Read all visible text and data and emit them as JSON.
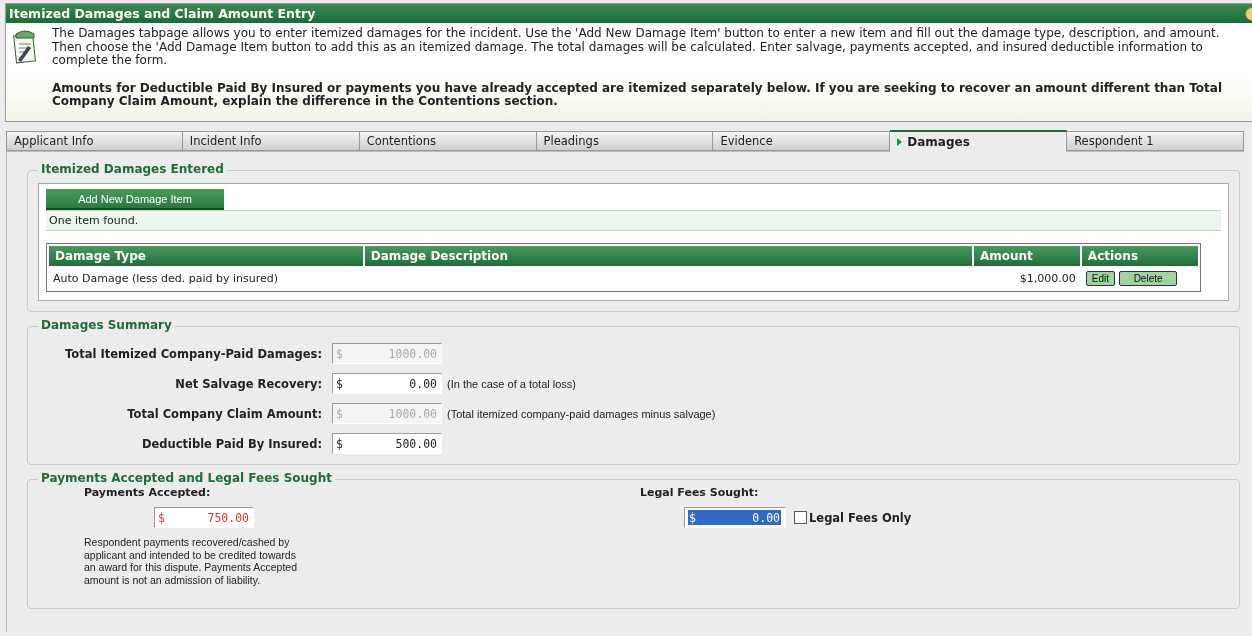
{
  "window": {
    "title": "Itemized Damages and Claim Amount Entry"
  },
  "intro": {
    "paragraphs": [
      {
        "kind": "note",
        "text": "The Damages tabpage allows you to enter itemized damages for the incident. Use the 'Add New Damage Item' button to enter a new item and fill out the damage type, description, and amount. Then choose the 'Add Damage Item button to add this as an itemized damage. The total damages will be calculated. Enter salvage, payments accepted, and insured deductible information to complete the form."
      },
      {
        "kind": "emphasis",
        "text": "Amounts for Deductible Paid By Insured or payments you have already accepted are itemized separately below. If you are seeking to recover an amount different than Total Company Claim Amount, explain the difference in the Contentions section."
      }
    ]
  },
  "tabs": [
    {
      "label": "Applicant Info",
      "selected": false
    },
    {
      "label": "Incident Info",
      "selected": false
    },
    {
      "label": "Contentions",
      "selected": false
    },
    {
      "label": "Pleadings",
      "selected": false
    },
    {
      "label": "Evidence",
      "selected": false
    },
    {
      "label": "Damages",
      "selected": true
    },
    {
      "label": "Respondent 1",
      "selected": false
    }
  ],
  "itemized": {
    "title": "Itemized Damages Entered",
    "add_button": "Add New Damage Item",
    "result_count": "One item found.",
    "table": {
      "columns": [
        "Damage Type",
        "Damage Description",
        "Amount",
        "Actions"
      ],
      "rows": [
        {
          "damage_type": "Auto Damage (less ded. paid by insured)",
          "amount": "$1,000.00",
          "actions": [
            "Edit",
            "Delete"
          ]
        }
      ]
    }
  },
  "summary": {
    "title": "Damages Summary",
    "fields": [
      {
        "label": "Total Itemized Company-Paid Damages:",
        "currency": "$",
        "value": "1000.00",
        "disabled": true
      },
      {
        "label": "Net Salvage Recovery:",
        "currency": "$",
        "value": "0.00",
        "disabled": false,
        "note": "(In the case of a total loss)"
      },
      {
        "label": "Total Company Claim Amount:",
        "currency": "$",
        "value": "1000.00",
        "disabled": true,
        "note": "(Total itemized company-paid damages minus salvage)"
      },
      {
        "label": "Deductible Paid By Insured:",
        "currency": "$",
        "value": "500.00",
        "disabled": false
      }
    ]
  },
  "payments": {
    "title": "Payments Accepted and Legal Fees Sought",
    "accepted": {
      "label": "Payments Accepted:",
      "currency": "$",
      "value": "750.00",
      "error": true,
      "help": "Respondent payments recovered/cashed by applicant and intended to be credited towards an award for this dispute. Payments Accepted amount is not an admission of liability."
    },
    "legal": {
      "label": "Legal Fees Sought:",
      "currency": "$",
      "value": "0.00",
      "highlighted": true,
      "checkbox": {
        "label": "Legal Fees Only",
        "checked": false
      }
    }
  }
}
